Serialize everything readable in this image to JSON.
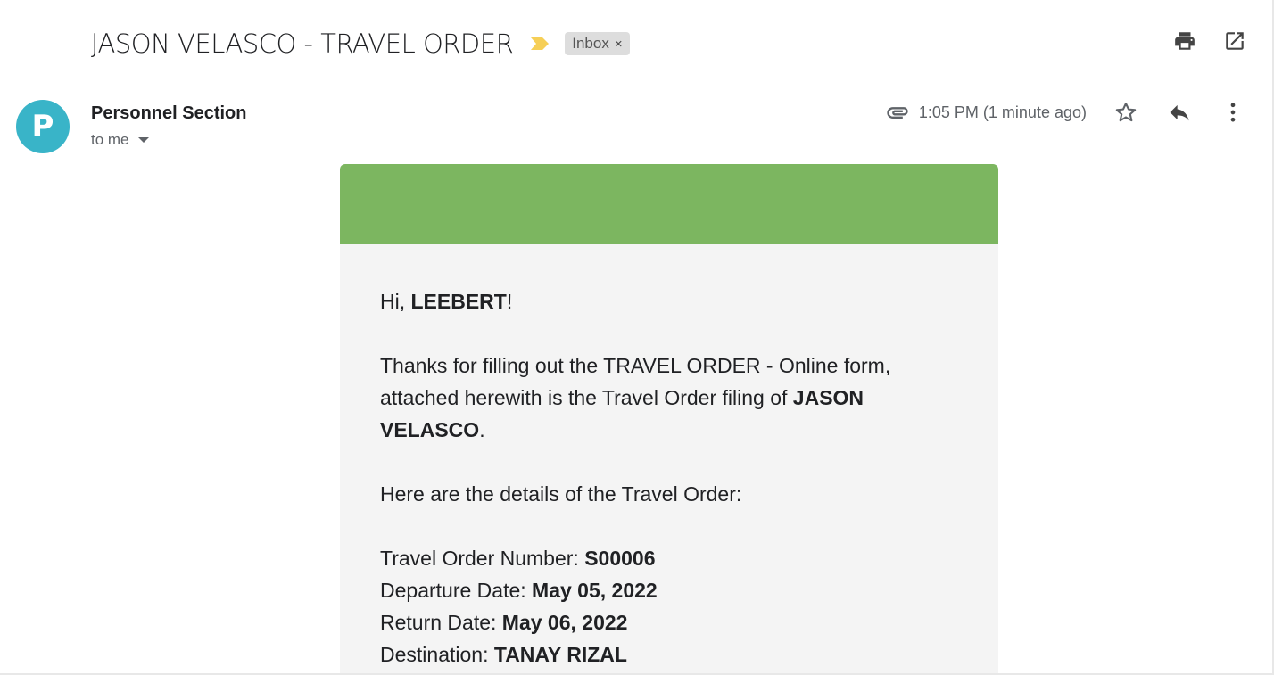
{
  "header": {
    "subject": "JASON VELASCO - TRAVEL ORDER",
    "label": "Inbox",
    "label_remove": "×",
    "icons": [
      "print-icon",
      "open-in-new-window-icon"
    ]
  },
  "message": {
    "avatar_letter": "P",
    "avatar_color": "#39b4c8",
    "sender": "Personnel Section",
    "recipient": "to me",
    "time": "1:05 PM (1 minute ago)",
    "icons": [
      "attachment-icon",
      "star-icon",
      "reply-icon",
      "more-options-icon"
    ]
  },
  "body": {
    "header_color": "#7cb660",
    "greeting_prefix": "Hi, ",
    "greeting_name": "LEEBERT",
    "greeting_suffix": "!",
    "intro_text": "Thanks for filling out the TRAVEL ORDER - Online form, attached herewith is the Travel Order filing of ",
    "intro_name": "JASON VELASCO",
    "intro_end": ".",
    "details_intro": "Here are the details of the Travel Order:",
    "details": [
      {
        "label": "Travel Order Number: ",
        "value": "S00006"
      },
      {
        "label": "Departure Date: ",
        "value": "May 05, 2022"
      },
      {
        "label": "Return Date: ",
        "value": "May 06, 2022"
      },
      {
        "label": "Destination: ",
        "value": "TANAY RIZAL"
      }
    ]
  }
}
